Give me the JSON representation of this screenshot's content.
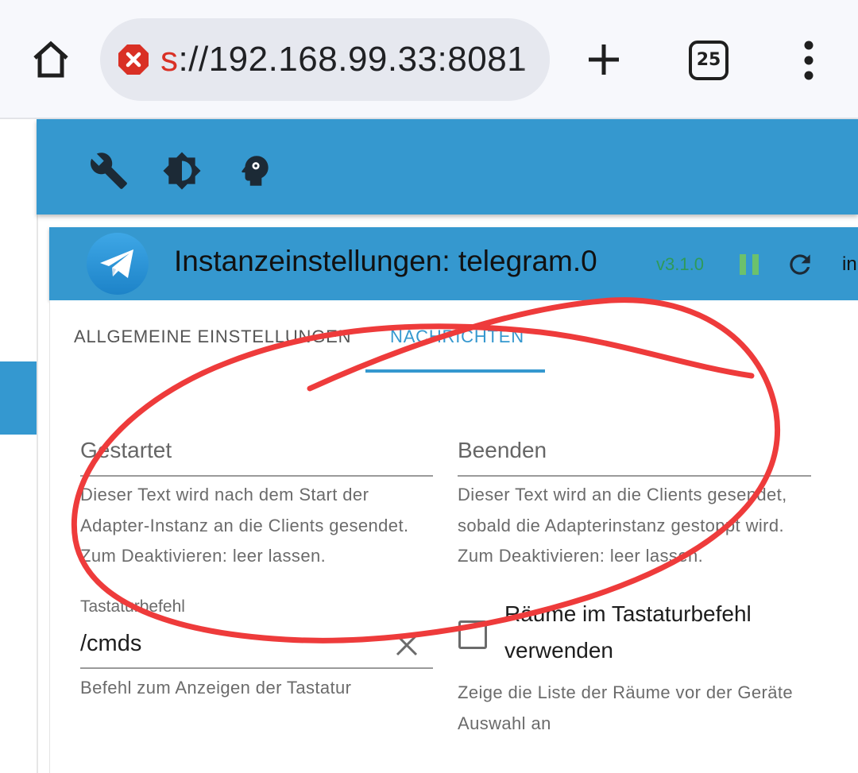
{
  "browser": {
    "url_scheme_tail": "s",
    "url_rest": "://192.168.99.33:8081",
    "tab_count": "25",
    "icons": [
      "home-icon",
      "not-secure-icon",
      "plus-icon",
      "tab-switcher-icon",
      "more-vert-icon"
    ]
  },
  "toolbar": {
    "icons": [
      "wrench-icon",
      "brightness-icon",
      "expert-mode-icon"
    ]
  },
  "instance": {
    "title": "Instanzeinstellungen: telegram.0",
    "version": "v3.1.0",
    "right_cut_text": "in"
  },
  "tabs": [
    {
      "label": "Allgemeine Einstellungen",
      "active": false
    },
    {
      "label": "Nachrichten",
      "active": true
    }
  ],
  "form": {
    "started": {
      "placeholder": "Gestartet",
      "help": "Dieser Text wird nach dem Start der Adapter-Instanz an die Clients gesendet. Zum Deaktivieren: leer lassen."
    },
    "stopped": {
      "placeholder": "Beenden",
      "help": "Dieser Text wird an die Clients gesendet, sobald die Adapterinstanz gestoppt wird. Zum Deaktivieren: leer lassen."
    },
    "keyboard": {
      "label": "Tastaturbefehl",
      "value": "/cmds",
      "help": "Befehl zum Anzeigen der Tastatur"
    },
    "rooms": {
      "checkbox_label": "Räume im Tastaturbefehl verwenden",
      "checked": false,
      "help": "Zeige die Liste der Räume vor der Geräte Auswahl an"
    }
  },
  "colors": {
    "primary": "#3598cf",
    "version": "#2e9a5a",
    "pause": "#6cc16c",
    "scribble": "#ee3b3b"
  }
}
